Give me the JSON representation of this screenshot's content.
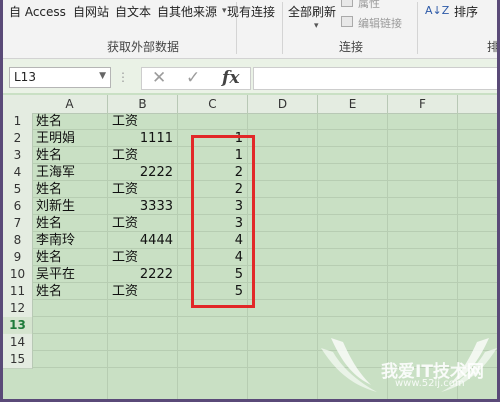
{
  "ribbon": {
    "from_access": "自 Access",
    "from_web": "自网站",
    "from_text": "自文本",
    "from_other": "自其他来源",
    "existing_connections": "现有连接",
    "refresh_all": "全部刷新",
    "properties": "属性",
    "edit_links": "编辑链接",
    "sort": "排序",
    "group_get_external": "获取外部数据",
    "group_connections": "连接",
    "group_sort": "排"
  },
  "formula_bar": {
    "name_box": "L13",
    "cancel_icon": "✕",
    "enter_icon": "✓",
    "fx_label": "fx",
    "formula": ""
  },
  "grid": {
    "columns": [
      "A",
      "B",
      "C",
      "D",
      "E",
      "F"
    ],
    "rows": [
      "1",
      "2",
      "3",
      "4",
      "5",
      "6",
      "7",
      "8",
      "9",
      "10",
      "11",
      "12",
      "13",
      "14",
      "15"
    ],
    "active_row": "13",
    "cells": {
      "A1": "姓名",
      "B1": "工资",
      "A2": "王明娟",
      "B2": "1111",
      "C2": "1",
      "A3": "姓名",
      "B3": "工资",
      "C3": "1",
      "A4": "王海军",
      "B4": "2222",
      "C4": "2",
      "A5": "姓名",
      "B5": "工资",
      "C5": "2",
      "A6": "刘新生",
      "B6": "3333",
      "C6": "3",
      "A7": "姓名",
      "B7": "工资",
      "C7": "3",
      "A8": "李南玲",
      "B8": "4444",
      "C8": "4",
      "A9": "姓名",
      "B9": "工资",
      "C9": "4",
      "A10": "吴平在",
      "B10": "2222",
      "C10": "5",
      "A11": "姓名",
      "B11": "工资",
      "C11": "5"
    },
    "highlight_color": "#e22828"
  },
  "watermark": {
    "title": "我爱IT技术网",
    "url": "www.52ij.com"
  }
}
